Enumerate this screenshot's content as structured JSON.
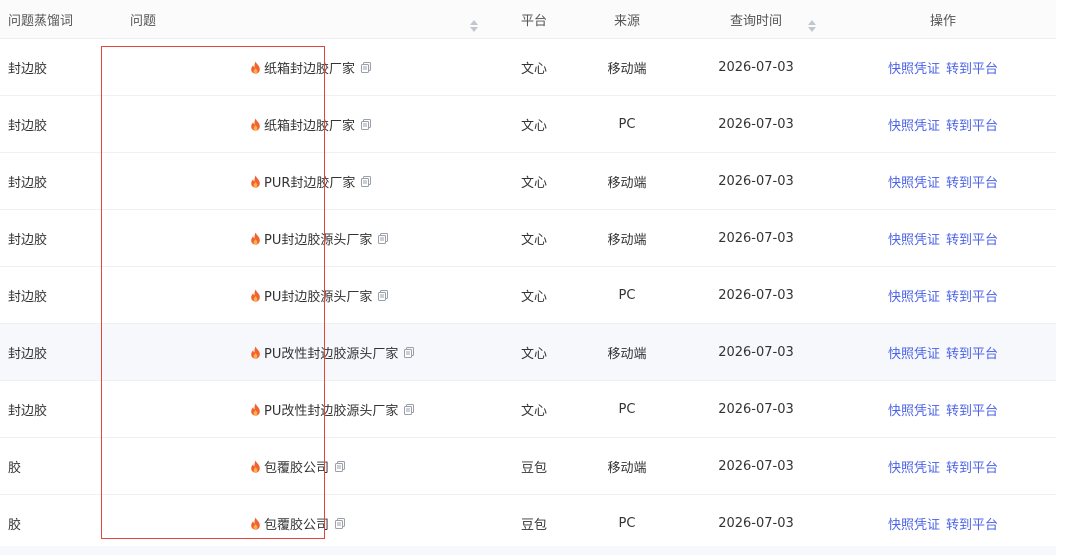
{
  "headers": {
    "keyword": "问题蒸馏词",
    "question": "问题",
    "platform": "平台",
    "source": "来源",
    "query_time": "查询时间",
    "actions": "操作"
  },
  "actions": {
    "snapshot": "快照凭证",
    "goto": "转到平台"
  },
  "colors": {
    "link": "#4b63e6",
    "highlight_box": "#e2453b",
    "fire": "#f2612e"
  },
  "rows": [
    {
      "keyword": "封边胶",
      "question": "纸箱封边胶厂家",
      "platform": "文心",
      "source": "移动端",
      "time": "2026-07-03"
    },
    {
      "keyword": "封边胶",
      "question": "纸箱封边胶厂家",
      "platform": "文心",
      "source": "PC",
      "time": "2026-07-03"
    },
    {
      "keyword": "封边胶",
      "question": "PUR封边胶厂家",
      "platform": "文心",
      "source": "移动端",
      "time": "2026-07-03"
    },
    {
      "keyword": "封边胶",
      "question": "PU封边胶源头厂家",
      "platform": "文心",
      "source": "移动端",
      "time": "2026-07-03"
    },
    {
      "keyword": "封边胶",
      "question": "PU封边胶源头厂家",
      "platform": "文心",
      "source": "PC",
      "time": "2026-07-03"
    },
    {
      "keyword": "封边胶",
      "question": "PU改性封边胶源头厂家",
      "platform": "文心",
      "source": "移动端",
      "time": "2026-07-03"
    },
    {
      "keyword": "封边胶",
      "question": "PU改性封边胶源头厂家",
      "platform": "文心",
      "source": "PC",
      "time": "2026-07-03"
    },
    {
      "keyword": "胶",
      "question": "包覆胶公司",
      "platform": "豆包",
      "source": "移动端",
      "time": "2026-07-03"
    },
    {
      "keyword": "胶",
      "question": "包覆胶公司",
      "platform": "豆包",
      "source": "PC",
      "time": "2026-07-03"
    }
  ]
}
